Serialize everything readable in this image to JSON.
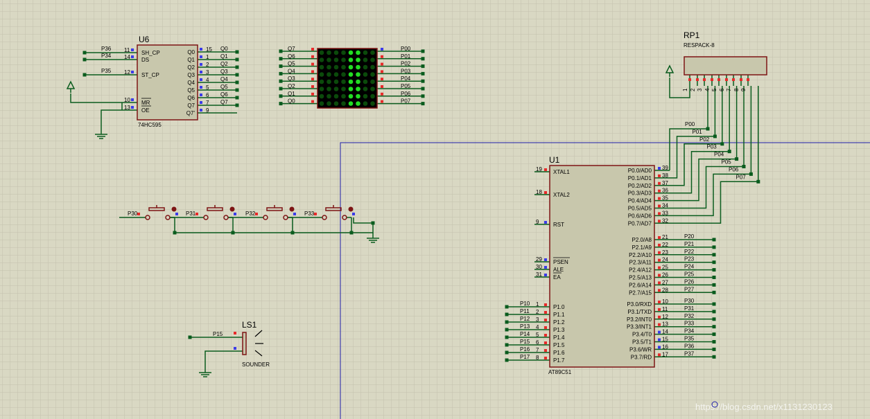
{
  "colors": {
    "background": "#d9d8c3",
    "grid": "#c2c1ad",
    "wire": "#0a5c1e",
    "body": "#c8c7ac",
    "outline": "#7d1414",
    "pinRed": "#e82a2a",
    "pinBlue": "#3b3be8",
    "ledOn": "#22dd22",
    "ledOff": "#0b4a0b"
  },
  "u6": {
    "ref": "U6",
    "part": "74HC595",
    "left_pins": [
      {
        "net": "P36",
        "num": "11",
        "name": "SH_CP"
      },
      {
        "net": "P34",
        "num": "14",
        "name": "DS"
      },
      {
        "net": "P35",
        "num": "12",
        "name": "ST_CP"
      },
      {
        "net": "",
        "num": "10",
        "name": "MR"
      },
      {
        "net": "",
        "num": "13",
        "name": "OE"
      }
    ],
    "right_pins": [
      {
        "num": "15",
        "name": "Q0",
        "net": "Q0"
      },
      {
        "num": "1",
        "name": "Q1",
        "net": "Q1"
      },
      {
        "num": "2",
        "name": "Q2",
        "net": "Q2"
      },
      {
        "num": "3",
        "name": "Q3",
        "net": "Q3"
      },
      {
        "num": "4",
        "name": "Q4",
        "net": "Q4"
      },
      {
        "num": "5",
        "name": "Q5",
        "net": "Q5"
      },
      {
        "num": "6",
        "name": "Q6",
        "net": "Q6"
      },
      {
        "num": "7",
        "name": "Q7",
        "net": "Q7"
      },
      {
        "num": "9",
        "name": "Q7'",
        "net": ""
      }
    ]
  },
  "matrix": {
    "left_nets": [
      "Q7",
      "Q6",
      "Q5",
      "Q4",
      "Q3",
      "Q2",
      "Q1",
      "Q0"
    ],
    "right_nets": [
      "P00",
      "P01",
      "P02",
      "P03",
      "P04",
      "P05",
      "P06",
      "P07"
    ],
    "lit_columns": [
      4,
      5
    ]
  },
  "rp1": {
    "ref": "RP1",
    "part": "RESPACK-8",
    "pin_nums": [
      "1",
      "2",
      "3",
      "4",
      "5",
      "6",
      "7",
      "8",
      "9"
    ]
  },
  "u1": {
    "ref": "U1",
    "part": "AT89C51",
    "left_pins": [
      {
        "num": "19",
        "name": "XTAL1",
        "net": ""
      },
      {
        "num": "18",
        "name": "XTAL2",
        "net": ""
      },
      {
        "num": "9",
        "name": "RST",
        "net": ""
      },
      {
        "num": "29",
        "name": "PSEN",
        "net": ""
      },
      {
        "num": "30",
        "name": "ALE",
        "net": ""
      },
      {
        "num": "31",
        "name": "EA",
        "net": ""
      },
      {
        "num": "1",
        "name": "P1.0",
        "net": "P10"
      },
      {
        "num": "2",
        "name": "P1.1",
        "net": "P11"
      },
      {
        "num": "3",
        "name": "P1.2",
        "net": "P12"
      },
      {
        "num": "4",
        "name": "P1.3",
        "net": "P13"
      },
      {
        "num": "5",
        "name": "P1.4",
        "net": "P14"
      },
      {
        "num": "6",
        "name": "P1.5",
        "net": "P15"
      },
      {
        "num": "7",
        "name": "P1.6",
        "net": "P16"
      },
      {
        "num": "8",
        "name": "P1.7",
        "net": "P17"
      }
    ],
    "p0_pins": [
      {
        "num": "39",
        "name": "P0.0/AD0",
        "net": "P00"
      },
      {
        "num": "38",
        "name": "P0.1/AD1",
        "net": "P01"
      },
      {
        "num": "37",
        "name": "P0.2/AD2",
        "net": "P02"
      },
      {
        "num": "36",
        "name": "P0.3/AD3",
        "net": "P03"
      },
      {
        "num": "35",
        "name": "P0.4/AD4",
        "net": "P04"
      },
      {
        "num": "34",
        "name": "P0.5/AD5",
        "net": "P05"
      },
      {
        "num": "33",
        "name": "P0.6/AD6",
        "net": "P06"
      },
      {
        "num": "32",
        "name": "P0.7/AD7",
        "net": "P07"
      }
    ],
    "p2_pins": [
      {
        "num": "21",
        "name": "P2.0/A8",
        "net": "P20"
      },
      {
        "num": "22",
        "name": "P2.1/A9",
        "net": "P21"
      },
      {
        "num": "23",
        "name": "P2.2/A10",
        "net": "P22"
      },
      {
        "num": "24",
        "name": "P2.3/A11",
        "net": "P23"
      },
      {
        "num": "25",
        "name": "P2.4/A12",
        "net": "P24"
      },
      {
        "num": "26",
        "name": "P2.5/A13",
        "net": "P25"
      },
      {
        "num": "27",
        "name": "P2.6/A14",
        "net": "P26"
      },
      {
        "num": "28",
        "name": "P2.7/A15",
        "net": "P27"
      }
    ],
    "p3_pins": [
      {
        "num": "10",
        "name": "P3.0/RXD",
        "net": "P30"
      },
      {
        "num": "11",
        "name": "P3.1/TXD",
        "net": "P31"
      },
      {
        "num": "12",
        "name": "P3.2/INT0",
        "net": "P32"
      },
      {
        "num": "13",
        "name": "P3.3/INT1",
        "net": "P33"
      },
      {
        "num": "14",
        "name": "P3.4/T0",
        "net": "P34"
      },
      {
        "num": "15",
        "name": "P3.5/T1",
        "net": "P35"
      },
      {
        "num": "16",
        "name": "P3.6/WR",
        "net": "P36"
      },
      {
        "num": "17",
        "name": "P3.7/RD",
        "net": "P37"
      }
    ]
  },
  "buttons": {
    "nets": [
      "P30",
      "P31",
      "P32",
      "P33"
    ]
  },
  "ls1": {
    "ref": "LS1",
    "part": "SOUNDER",
    "net": "P15"
  },
  "watermark": "https://blog.csdn.net/x1131230123"
}
